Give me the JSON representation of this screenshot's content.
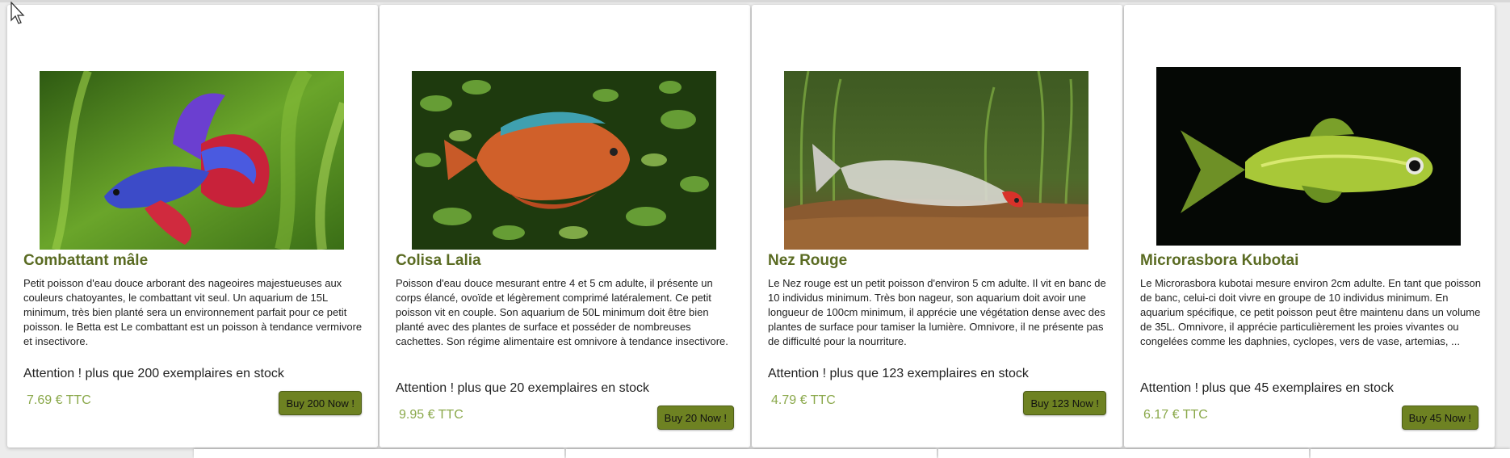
{
  "products": [
    {
      "title": "Combattant mâle",
      "description": "Petit poisson d'eau douce arborant des nageoires majestueuses aux couleurs chatoyantes, le combattant vit seul. Un aquarium de 15L minimum, très bien planté sera un environnement parfait pour ce petit poisson. le Betta est Le combattant est un poisson à tendance vermivore et insectivore.",
      "stock": "Attention ! plus que 200 exemplaires en stock",
      "price": "7.69 € TTC",
      "button": "Buy 200 Now !",
      "image": "betta-fish-image"
    },
    {
      "title": "Colisa Lalia",
      "description": "Poisson d'eau douce mesurant entre 4 et 5 cm adulte, il présente un corps élancé, ovoïde et légèrement comprimé latéralement. Ce petit poisson vit en couple. Son aquarium de 50L minimum doit être bien planté avec des plantes de surface et posséder de nombreuses cachettes. Son régime alimentaire est omnivore à tendance insectivore.",
      "stock": "Attention ! plus que 20 exemplaires en stock",
      "price": "9.95 € TTC",
      "button": "Buy 20 Now !",
      "image": "gourami-fish-image"
    },
    {
      "title": "Nez Rouge",
      "description": "Le Nez rouge est un petit poisson d'environ 5 cm adulte. Il vit en banc de 10 individus minimum. Très bon nageur, son aquarium doit avoir une longueur de 100cm minimum, il apprécie une végétation dense avec des plantes de surface pour tamiser la lumière. Omnivore, il ne présente pas de difficulté pour la nourriture.",
      "stock": "Attention ! plus que 123 exemplaires en stock",
      "price": "4.79 € TTC",
      "button": "Buy 123 Now !",
      "image": "rummy-nose-tetra-image"
    },
    {
      "title": "Microrasbora Kubotai",
      "description": "Le Microrasbora kubotai mesure environ 2cm adulte. En tant que poisson de banc, celui-ci doit vivre en groupe de 10 individus minimum. En aquarium spécifique, ce petit poisson peut être maintenu dans un volume de 35L. Omnivore, il apprécie particulièrement les proies vivantes ou congelées comme les daphnies, cyclopes, vers de vase, artemias, ...",
      "stock": "Attention ! plus que 45 exemplaires en stock",
      "price": "6.17 € TTC",
      "button": "Buy 45 Now !",
      "image": "microrasbora-fish-image"
    }
  ],
  "colors": {
    "title": "#5a6b22",
    "price": "#8aa84a",
    "button": "#6e8222"
  }
}
